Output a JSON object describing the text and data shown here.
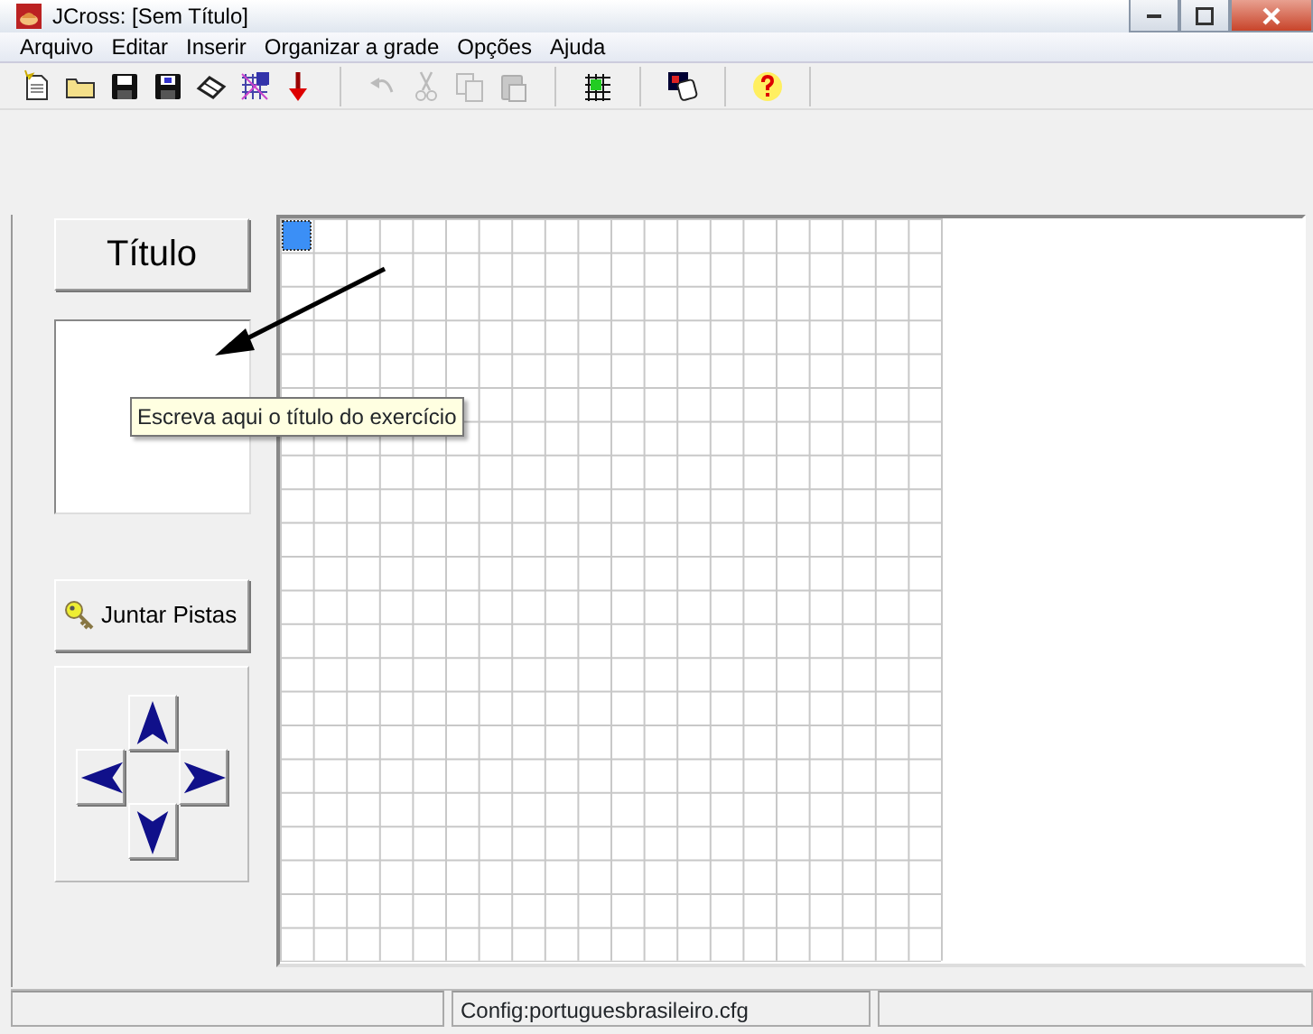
{
  "window": {
    "title": "JCross: [Sem Título]"
  },
  "menu": [
    "Arquivo",
    "Editar",
    "Inserir",
    "Organizar a grade",
    "Opções",
    "Ajuda"
  ],
  "toolbar": [
    {
      "kind": "new",
      "disabled": false
    },
    {
      "kind": "open",
      "disabled": false
    },
    {
      "kind": "save",
      "disabled": false
    },
    {
      "kind": "saveas",
      "disabled": false
    },
    {
      "kind": "eraser",
      "disabled": false
    },
    {
      "kind": "gridsix",
      "disabled": false
    },
    {
      "kind": "down",
      "disabled": false
    },
    {
      "kind": "separator"
    },
    {
      "kind": "undo",
      "disabled": true
    },
    {
      "kind": "cut",
      "disabled": true
    },
    {
      "kind": "copy",
      "disabled": true
    },
    {
      "kind": "paste",
      "disabled": true
    },
    {
      "kind": "separator"
    },
    {
      "kind": "grid",
      "disabled": false
    },
    {
      "kind": "separator"
    },
    {
      "kind": "image",
      "disabled": false
    },
    {
      "kind": "separator"
    },
    {
      "kind": "help",
      "disabled": false
    },
    {
      "kind": "separator"
    }
  ],
  "title_button": "Título",
  "gather_button": "Juntar Pistas",
  "grid": {
    "cursor_shown": true
  },
  "tooltip": "Escreva aqui o título do exercício",
  "status_bar": {
    "config": "Config:portuguesbrasileiro.cfg"
  }
}
